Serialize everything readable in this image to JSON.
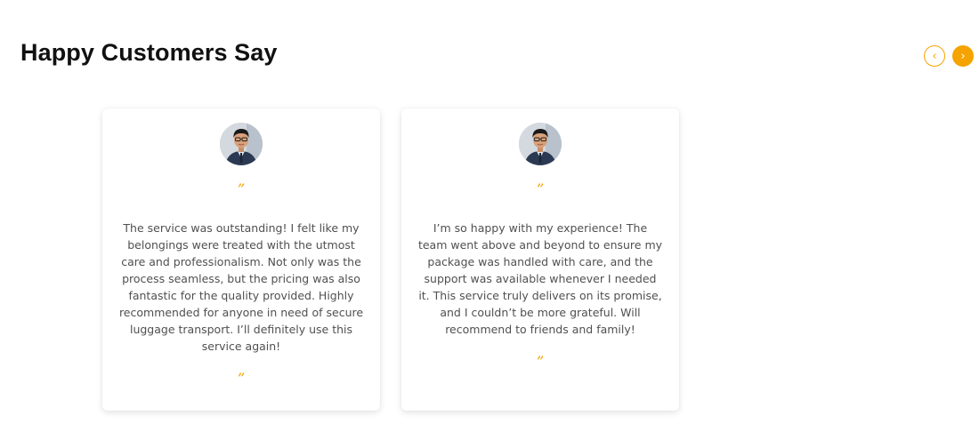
{
  "section": {
    "title": "Happy Customers Say"
  },
  "carousel": {
    "prev_icon": "‹",
    "next_icon": "›"
  },
  "accent_color": "#f5a300",
  "testimonials": [
    {
      "quote_open": "”",
      "text": "The service was outstanding! I felt like my belongings were treated with the utmost care and professionalism. Not only was the process seamless, but the pricing was also fantastic for the quality provided. Highly recommended for anyone in need of secure luggage transport. I’ll definitely use this service again!",
      "quote_close": "”"
    },
    {
      "quote_open": "”",
      "text": "I’m so happy with my experience! The team went above and beyond to ensure my package was handled with care, and the support was available whenever I needed it. This service truly delivers on its promise, and I couldn’t be more grateful. Will recommend to friends and family!",
      "quote_close": "”"
    }
  ]
}
